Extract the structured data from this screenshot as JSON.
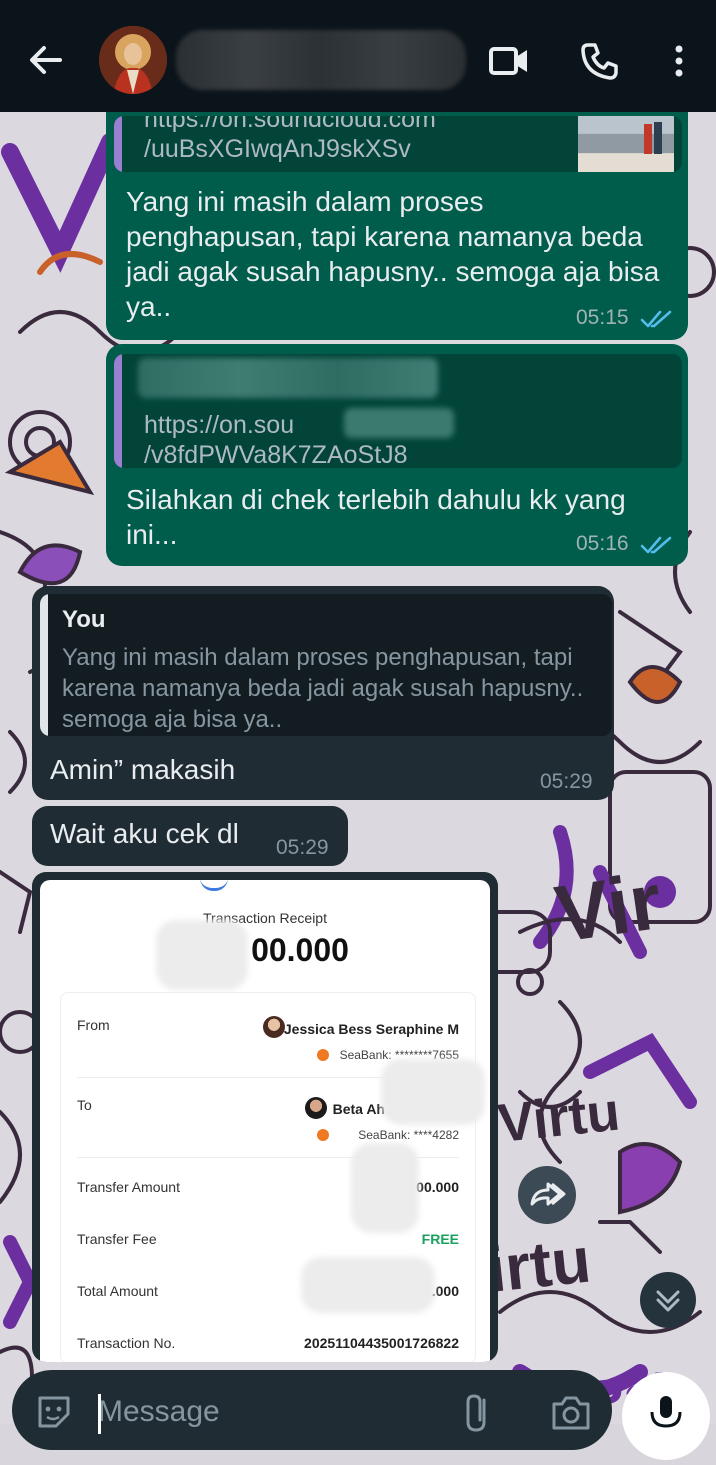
{
  "header": {
    "back_icon": "arrow-left-icon",
    "video_icon": "video-call-icon",
    "call_icon": "phone-icon",
    "menu_icon": "more-vertical-icon"
  },
  "messages": {
    "m1": {
      "link_line1": "https://on.soundcloud.com",
      "link_line2": "/uuBsXGIwqAnJ9skXSv",
      "text": "Yang ini masih dalam proses penghapusan, tapi karena namanya beda jadi agak susah hapusny.. semoga aja bisa ya..",
      "time": "05:15"
    },
    "m2": {
      "link_line1": "https://on.sou              m",
      "link_line2": "/v8fdPWVa8K7ZAoStJ8",
      "text": "Silahkan di chek terlebih dahulu kk yang ini...",
      "time": "05:16"
    },
    "m3": {
      "reply_author": "You",
      "reply_text": "Yang ini masih dalam proses penghapusan, tapi karena namanya beda jadi agak susah hapusny.. semoga aja bisa ya..",
      "text": "Amin” makasih",
      "time": "05:29"
    },
    "m4": {
      "text": "Wait aku cek dl",
      "time": "05:29"
    }
  },
  "receipt": {
    "title": "Transaction Receipt",
    "amount": "00.000",
    "from_label": "From",
    "from_name": "Jessica Bess Seraphine M",
    "from_bank": "SeaBank: ********7655",
    "to_label": "To",
    "to_name": "Beta Ah",
    "to_bank": "SeaBank: ****4282",
    "transfer_amount_label": "Transfer Amount",
    "transfer_amount": "00.000",
    "fee_label": "Transfer Fee",
    "fee": "FREE",
    "total_label": "Total Amount",
    "total": ".000",
    "txn_label": "Transaction No.",
    "txn": "20251104435001726822"
  },
  "input": {
    "placeholder": "Message"
  },
  "colors": {
    "outgoing": "#005c4b",
    "incoming": "#1f2c33",
    "read_ticks": "#53bdeb",
    "header_bg": "#0b141a"
  }
}
